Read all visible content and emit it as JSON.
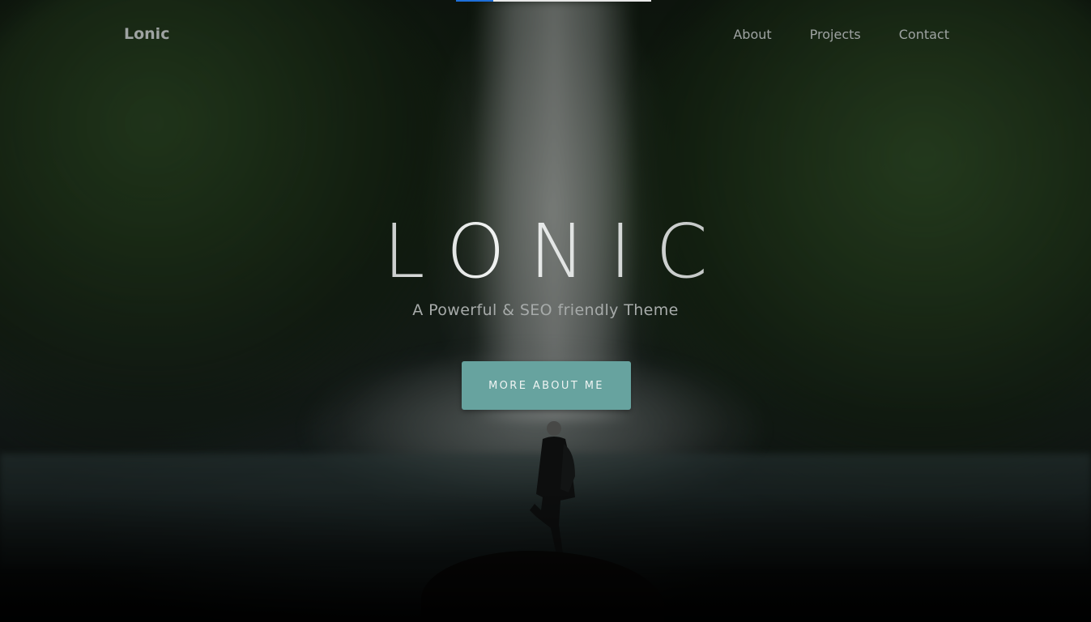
{
  "navbar": {
    "brand": "Lonic",
    "links": [
      {
        "label": "About"
      },
      {
        "label": "Projects"
      },
      {
        "label": "Contact"
      }
    ]
  },
  "hero": {
    "title": "LONIC",
    "subtitle": "A Powerful & SEO friendly Theme",
    "cta_label": "MORE ABOUT ME"
  },
  "scroll_progress": {
    "fraction": 0.19
  },
  "colors": {
    "accent": "#67a39f",
    "progress_fill": "#1e6fd9",
    "nav_text": "#9ea3a2"
  }
}
